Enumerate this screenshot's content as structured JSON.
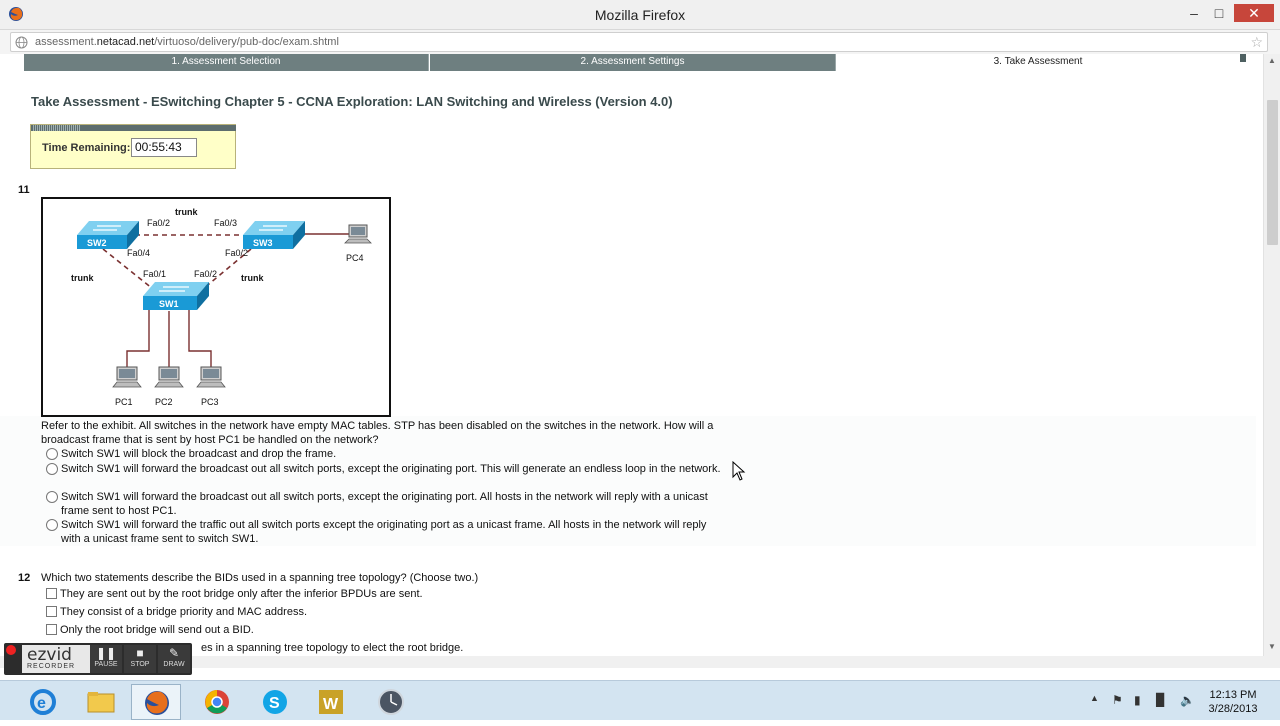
{
  "window": {
    "title": "Mozilla Firefox"
  },
  "address": {
    "url_prefix": "assessment.",
    "url_domain": "netacad.net",
    "url_path": "/virtuoso/delivery/pub-doc/exam.shtml"
  },
  "steps": [
    {
      "label": "1. Assessment Selection"
    },
    {
      "label": "2. Assessment Settings"
    },
    {
      "label": "3. Take Assessment"
    }
  ],
  "page": {
    "title": "Take Assessment - ESwitching Chapter 5 - CCNA Exploration: LAN Switching and Wireless (Version 4.0)"
  },
  "timer": {
    "label": "Time Remaining:",
    "value": "00:55:43"
  },
  "q11": {
    "number": "11",
    "text": "Refer to the exhibit. All switches in the network have empty MAC tables. STP has been disabled on the switches in the network. How will a broadcast frame that is sent by host PC1 be handled on the network?",
    "options": [
      "Switch SW1 will block the broadcast and drop the frame.",
      "Switch SW1 will forward the broadcast out all switch ports, except the originating port. This will generate an endless loop in the network.",
      "Switch SW1 will forward the broadcast out all switch ports, except the originating port. All hosts in the network will reply with a unicast frame sent to host PC1.",
      "Switch SW1 will forward the traffic out all switch ports except the originating port as a unicast frame. All hosts in the network will reply with a unicast frame sent to switch SW1."
    ],
    "exhibit": {
      "trunk_top": "trunk",
      "trunk_left": "trunk",
      "trunk_right": "trunk",
      "sw2": "SW2",
      "sw3": "SW3",
      "sw1": "SW1",
      "sw2_fa02": "Fa0/2",
      "sw3_fa03": "Fa0/3",
      "sw2_fa04": "Fa0/4",
      "sw3_fa02": "Fa0/2",
      "sw1_fa01": "Fa0/1",
      "sw1_fa02": "Fa0/2",
      "pc1": "PC1",
      "pc2": "PC2",
      "pc3": "PC3",
      "pc4": "PC4"
    }
  },
  "q12": {
    "number": "12",
    "text": "Which two statements describe the BIDs used in a spanning tree topology? (Choose two.)",
    "options": [
      "They are sent out by the root bridge only after the inferior BPDUs are sent.",
      "They consist of a bridge priority and MAC address.",
      "Only the root bridge will send out a BID.",
      "es in a spanning tree topology to elect the root bridge."
    ]
  },
  "ezvid": {
    "logo": "ezvid",
    "sub": "RECORDER",
    "pause": "PAUSE",
    "stop": "STOP",
    "draw": "DRAW"
  },
  "taskbar": {
    "apps": [
      "internet-explorer-icon",
      "file-explorer-icon",
      "firefox-icon",
      "chrome-icon",
      "skype-icon",
      "word-icon",
      "clock-app-icon"
    ],
    "time": "12:13 PM",
    "date": "3/28/2013"
  },
  "colors": {
    "step_inactive": "#6e7f80",
    "timer_bg": "#ffffc8",
    "switch_blue": "#1a9ad6",
    "trunk_line": "#7a3030"
  }
}
